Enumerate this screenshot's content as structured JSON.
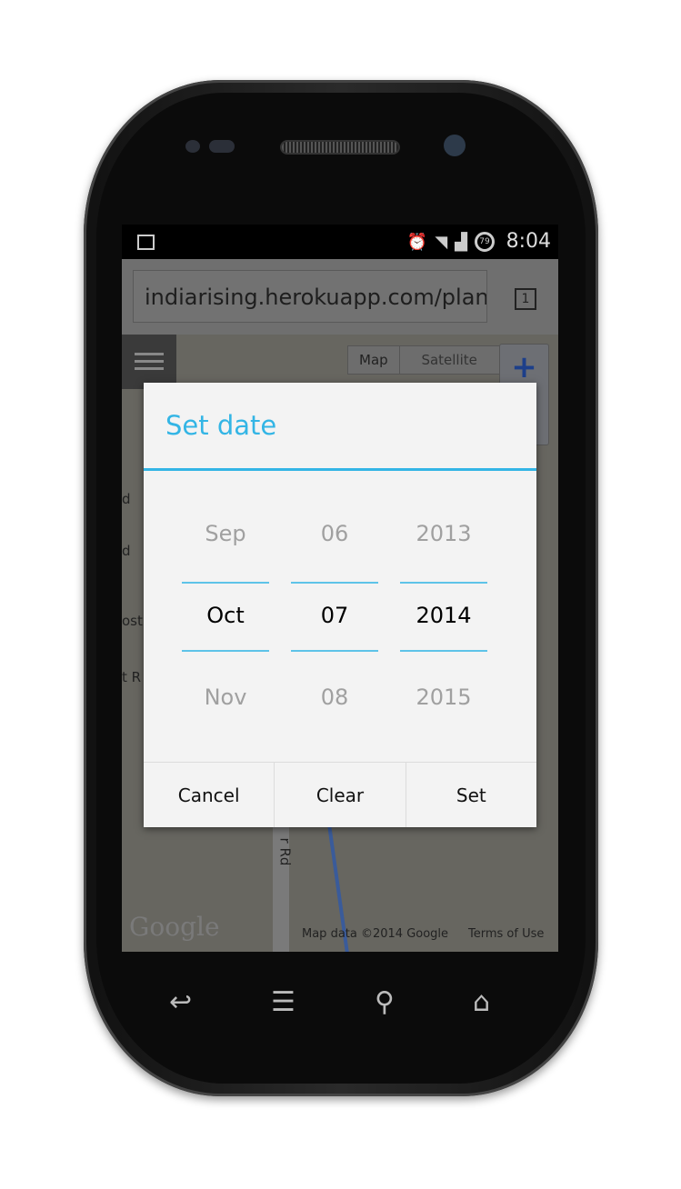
{
  "status_bar": {
    "time": "8:04",
    "battery": "79",
    "icons": [
      "image-icon",
      "alarm-icon",
      "wifi-icon",
      "signal-icon",
      "battery-icon"
    ]
  },
  "browser": {
    "url": "indiarising.herokuapp.com/plan",
    "tab_count": "1"
  },
  "map": {
    "map_label": "Map",
    "satellite_label": "Satellite",
    "zoom_in": "+",
    "road_labels": [
      "d",
      "d",
      "ost",
      "t R",
      "r Rd"
    ],
    "logo": "Google",
    "attribution": "Map data ©2014 Google",
    "terms": "Terms of Use"
  },
  "dialog": {
    "title": "Set date",
    "accent": "#33b5e5",
    "month": {
      "prev": "Sep",
      "current": "Oct",
      "next": "Nov"
    },
    "day": {
      "prev": "06",
      "current": "07",
      "next": "08"
    },
    "year": {
      "prev": "2013",
      "current": "2014",
      "next": "2015"
    },
    "cancel": "Cancel",
    "clear": "Clear",
    "set": "Set"
  },
  "nav": {
    "icons": [
      "back-icon",
      "menu-icon",
      "search-icon",
      "home-icon"
    ]
  }
}
